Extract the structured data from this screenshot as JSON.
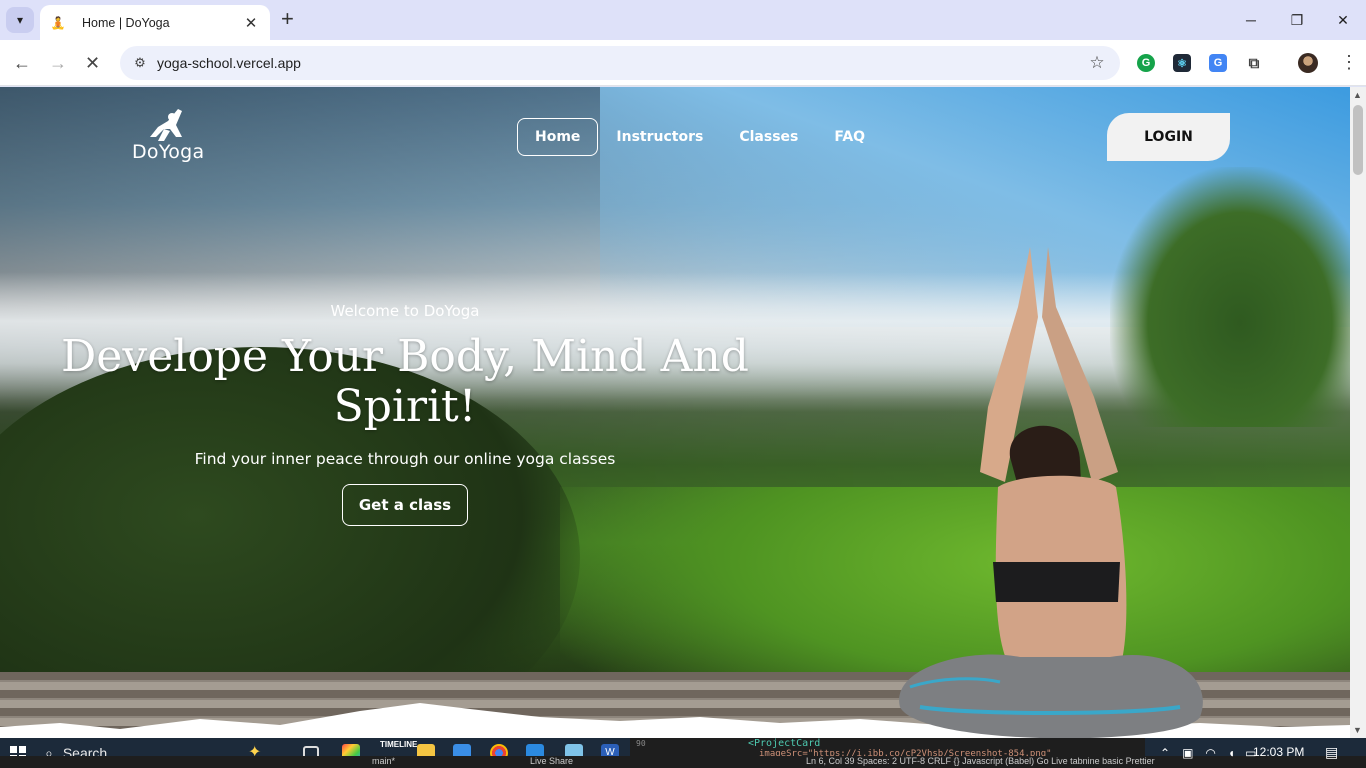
{
  "browser": {
    "tab_title": "Home | DoYoga",
    "url": "yoga-school.vercel.app",
    "new_tab_symbol": "+",
    "close_symbol": "✕"
  },
  "site": {
    "logo_text": "DoYoga",
    "nav": [
      {
        "label": "Home",
        "active": true
      },
      {
        "label": "Instructors",
        "active": false
      },
      {
        "label": "Classes",
        "active": false
      },
      {
        "label": "FAQ",
        "active": false
      }
    ],
    "login_label": "LOGIN"
  },
  "hero": {
    "welcome": "Welcome to DoYoga",
    "headline_line1": "Develope Your Body, Mind And",
    "headline_line2": "Spirit!",
    "subtitle": "Find your inner peace through our online yoga classes",
    "cta_label": "Get a class"
  },
  "taskbar": {
    "search_label": "Search",
    "timeline_label": "TIMELINE",
    "branch": "main*",
    "code_line_num": "90",
    "code_snippet": "<ProjectCard",
    "code_snippet2": "imageSrc=\"https://i.ibb.co/cP2Vhsb/Screenshot-854.png\"",
    "status": "Ln 6, Col 39   Spaces: 2   UTF-8   CRLF   {} Javascript (Babel)   Go Live   tabnine basic   Prettier",
    "live_share": "Live Share",
    "clock": "12:03 PM"
  },
  "colors": {
    "tabbar_bg": "#dee1f9",
    "omnibox_bg": "#edf0fb",
    "login_bg": "#f2f2f2",
    "taskbar_bg": "#1c2a3a"
  }
}
